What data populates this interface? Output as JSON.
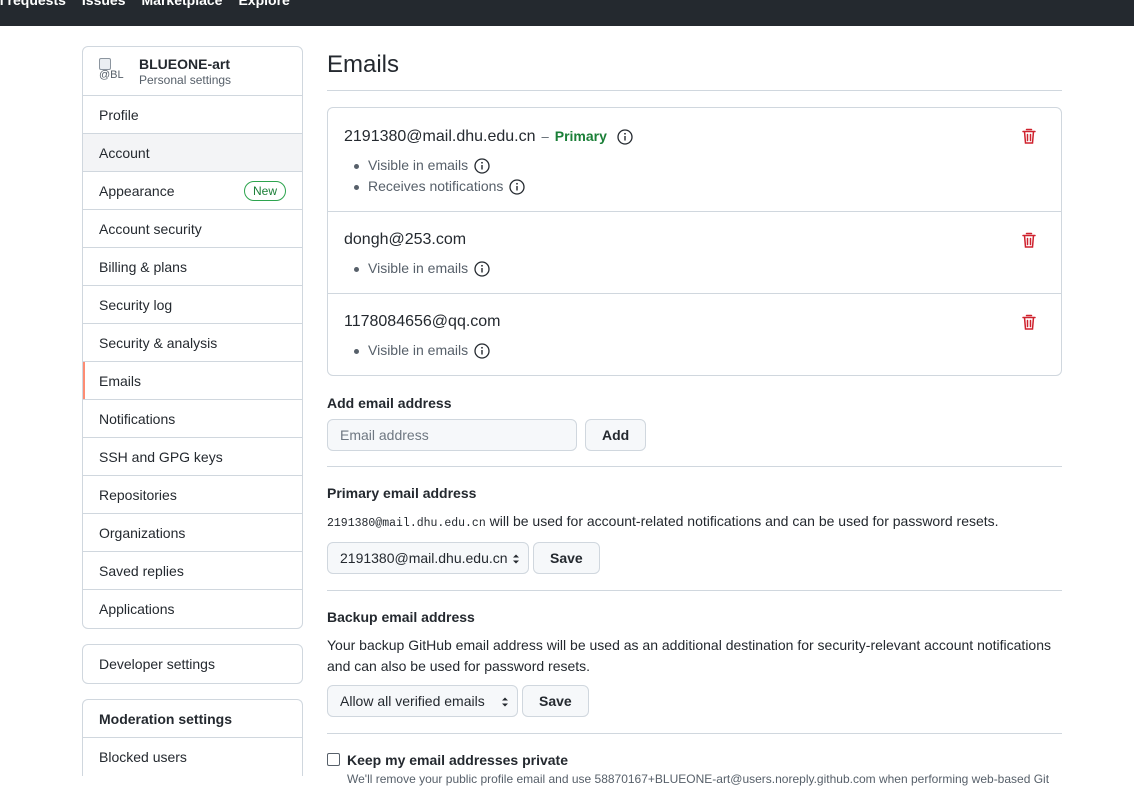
{
  "topnav": {
    "links": [
      "Pull requests",
      "Issues",
      "Marketplace",
      "Explore"
    ]
  },
  "sidebar": {
    "user": {
      "avatar_alt": "@BL",
      "name": "BLUEONE-art",
      "subtitle": "Personal settings"
    },
    "items": [
      {
        "label": "Profile"
      },
      {
        "label": "Account"
      },
      {
        "label": "Appearance",
        "badge": "New"
      },
      {
        "label": "Account security"
      },
      {
        "label": "Billing & plans"
      },
      {
        "label": "Security log"
      },
      {
        "label": "Security & analysis"
      },
      {
        "label": "Emails"
      },
      {
        "label": "Notifications"
      },
      {
        "label": "SSH and GPG keys"
      },
      {
        "label": "Repositories"
      },
      {
        "label": "Organizations"
      },
      {
        "label": "Saved replies"
      },
      {
        "label": "Applications"
      }
    ],
    "developer": {
      "label": "Developer settings"
    },
    "moderation": {
      "heading": "Moderation settings",
      "items": [
        {
          "label": "Blocked users"
        }
      ]
    }
  },
  "main": {
    "title": "Emails",
    "emails": [
      {
        "address": "2191380@mail.dhu.edu.cn",
        "separator": "–",
        "primary_label": "Primary",
        "props": [
          "Visible in emails",
          "Receives notifications"
        ]
      },
      {
        "address": "dongh@253.com",
        "props": [
          "Visible in emails"
        ]
      },
      {
        "address": "1178084656@qq.com",
        "props": [
          "Visible in emails"
        ]
      }
    ],
    "add_email": {
      "label": "Add email address",
      "placeholder": "Email address",
      "button": "Add"
    },
    "primary_email": {
      "label": "Primary email address",
      "mono_email": "2191380@mail.dhu.edu.cn",
      "description": " will be used for account-related notifications and can be used for password resets.",
      "selected": "2191380@mail.dhu.edu.cn",
      "button": "Save"
    },
    "backup_email": {
      "label": "Backup email address",
      "description": "Your backup GitHub email address will be used as an additional destination for security-relevant account notifications and can also be used for password resets.",
      "selected": "Allow all verified emails",
      "button": "Save"
    },
    "keep_private": {
      "label": "Keep my email addresses private",
      "note": "We'll remove your public profile email and use 58870167+BLUEONE-art@users.noreply.github.com when performing web-based Git"
    }
  },
  "colors": {
    "accent": "#fd8c73",
    "primary_green": "#1a7f37",
    "danger": "#cf222e",
    "border": "#d0d7de"
  }
}
